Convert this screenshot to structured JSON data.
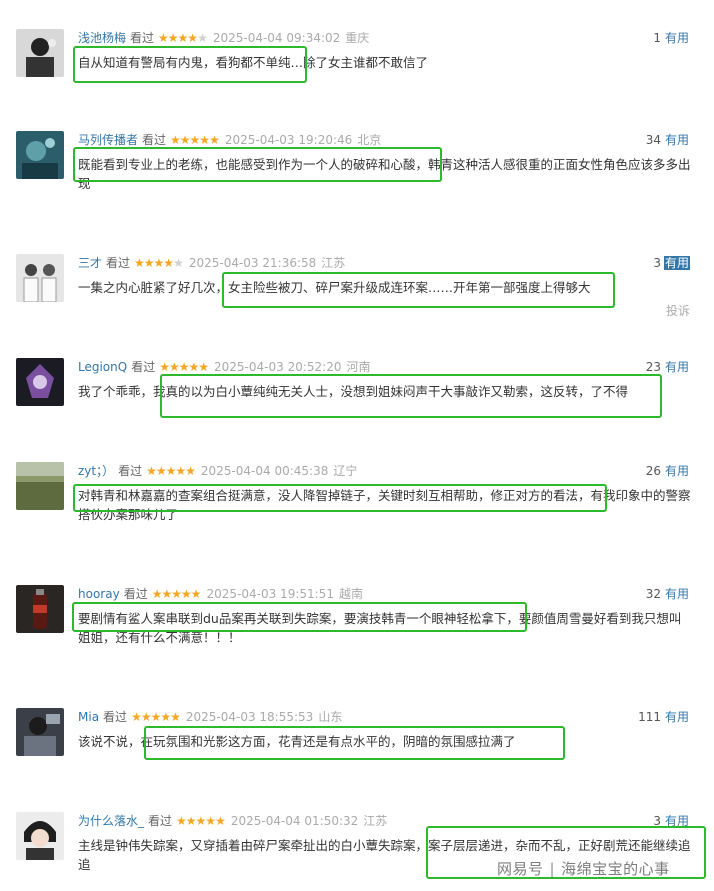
{
  "comments": [
    {
      "user": "浅池杨梅",
      "watched": "看过",
      "stars": 4,
      "time": "2025-04-04 09:34:02",
      "location": "重庆",
      "useful_count": "1",
      "useful_label": "有用",
      "text": "自从知道有警局有内鬼，看狗都不单纯…除了女主谁都不敢信了"
    },
    {
      "user": "马列传播者",
      "watched": "看过",
      "stars": 5,
      "time": "2025-04-03 19:20:46",
      "location": "北京",
      "useful_count": "34",
      "useful_label": "有用",
      "text": "既能看到专业上的老练，也能感受到作为一个人的破碎和心酸，韩青这种活人感很重的正面女性角色应该多多出现"
    },
    {
      "user": "三才",
      "watched": "看过",
      "stars": 4,
      "time": "2025-04-03 21:36:58",
      "location": "江苏",
      "useful_count": "3",
      "useful_label": "有用",
      "text": "一集之内心脏紧了好几次，女主险些被刀、碎尸案升级成连环案……开年第一部强度上得够大",
      "report": "投诉"
    },
    {
      "user": "LegionQ",
      "watched": "看过",
      "stars": 5,
      "time": "2025-04-03 20:52:20",
      "location": "河南",
      "useful_count": "23",
      "useful_label": "有用",
      "text": "我了个乖乖，我真的以为白小蕈纯纯无关人士，没想到姐妹闷声干大事敲诈又勒索，这反转，了不得"
    },
    {
      "user": "zyt；）",
      "watched": "看过",
      "stars": 5,
      "time": "2025-04-04 00:45:38",
      "location": "辽宁",
      "useful_count": "26",
      "useful_label": "有用",
      "text": "对韩青和林嘉嘉的查案组合挺满意，没人降智掉链子，关键时刻互相帮助，修正对方的看法，有我印象中的警察搭伙办案那味儿了"
    },
    {
      "user": "hooray",
      "watched": "看过",
      "stars": 5,
      "time": "2025-04-03 19:51:51",
      "location": "越南",
      "useful_count": "32",
      "useful_label": "有用",
      "text": "要剧情有鲨人案串联到du品案再关联到失踪案，要演技韩青一个眼神轻松拿下，要颜值周雪曼好看到我只想叫姐姐，还有什么不满意！！！"
    },
    {
      "user": "Mia",
      "watched": "看过",
      "stars": 5,
      "time": "2025-04-03 18:55:53",
      "location": "山东",
      "useful_count": "111",
      "useful_label": "有用",
      "text": "该说不说，在玩氛围和光影这方面，花青还是有点水平的，阴暗的氛围感拉满了"
    },
    {
      "user": "为什么落水_",
      "watched": "看过",
      "stars": 5,
      "time": "2025-04-04 01:50:32",
      "location": "江苏",
      "useful_count": "3",
      "useful_label": "有用",
      "text": "主线是钟伟失踪案，又穿插着由碎尸案牵扯出的白小蕈失踪案，案子层层递进，杂而不乱，正好剧荒还能继续追追"
    }
  ],
  "watermark": {
    "platform": "网易号",
    "separator": "|",
    "author": "海绵宝宝的心事"
  },
  "colors": {
    "highlight_box": "#2db82d",
    "username": "#3377aa",
    "star": "#f5a623"
  }
}
